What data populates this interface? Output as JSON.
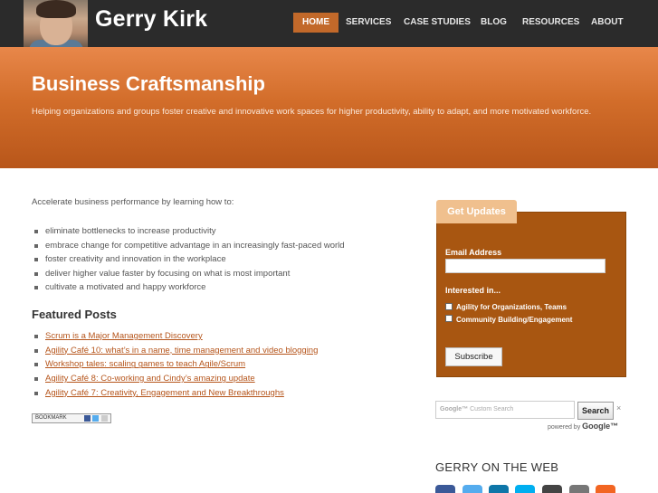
{
  "header": {
    "site_title": "Gerry Kirk",
    "nav": [
      "HOME",
      "SERVICES",
      "CASE STUDIES",
      "BLOG",
      "RESOURCES",
      "ABOUT"
    ]
  },
  "hero": {
    "title": "Business Craftsmanship",
    "tagline": "Helping organizations and groups foster creative and innovative work spaces for higher productivity, ability to adapt, and more motivated workforce."
  },
  "main": {
    "intro": "Accelerate business performance by learning how to:",
    "bullets": [
      "eliminate bottlenecks to increase productivity",
      "embrace change for competitive advantage in an increasingly fast-paced world",
      "foster creativity and innovation in the workplace",
      "deliver higher value faster by focusing on what is most important",
      "cultivate a motivated and happy workforce"
    ],
    "featured_title": "Featured Posts",
    "posts": [
      "Scrum is a Major Management Discovery",
      "Agility Café 10: what’s in a name, time management and video blogging",
      "Workshop tales: scaling games to teach Agile/Scrum",
      "Agility Café 8: Co-working and Cindy’s amazing update",
      "Agility Café 7: Creativity, Engagement and New Breakthroughs"
    ],
    "bookmark_label": "BOOKMARK"
  },
  "sidebar": {
    "updates_title": "Get Updates",
    "email_label": "Email Address",
    "interested_label": "Interested in...",
    "options": [
      "Agility for Organizations, Teams",
      "Community Building/Engagement"
    ],
    "subscribe_label": "Subscribe",
    "search_placeholder": "Custom Search",
    "search_google": "Google™",
    "search_button": "Search",
    "search_clear": "×",
    "powered_by": "powered by",
    "powered_google": "Google™",
    "web_title": "GERRY ON THE WEB"
  },
  "colors": {
    "header_bg": "#2b2b2b",
    "accent": "#c2692a",
    "updates_box": "#a85611",
    "link": "#b5541a"
  },
  "social_icons": [
    "facebook-icon",
    "twitter-icon",
    "linkedin-icon",
    "skype-icon",
    "github-icon",
    "email-icon",
    "rss-icon"
  ]
}
